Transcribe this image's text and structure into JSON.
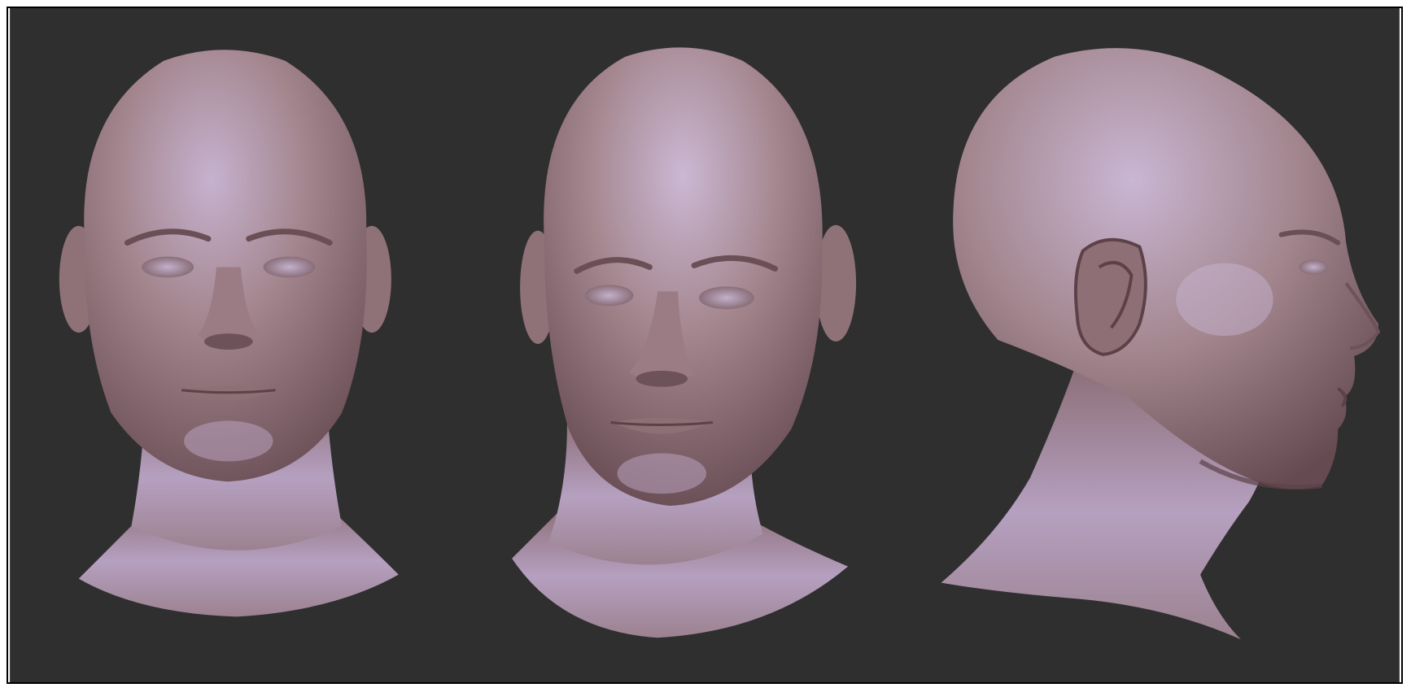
{
  "viewport": {
    "background": "#2f2f2f",
    "border_color": "#000000"
  },
  "material": {
    "base": "#a07f86",
    "highlight": "#c9b7d2",
    "shadow": "#5c4248"
  },
  "views": [
    {
      "view": "front",
      "icon": "head-front-icon"
    },
    {
      "view": "three-quarter",
      "icon": "head-three-quarter-icon"
    },
    {
      "view": "side",
      "icon": "head-side-icon"
    }
  ]
}
